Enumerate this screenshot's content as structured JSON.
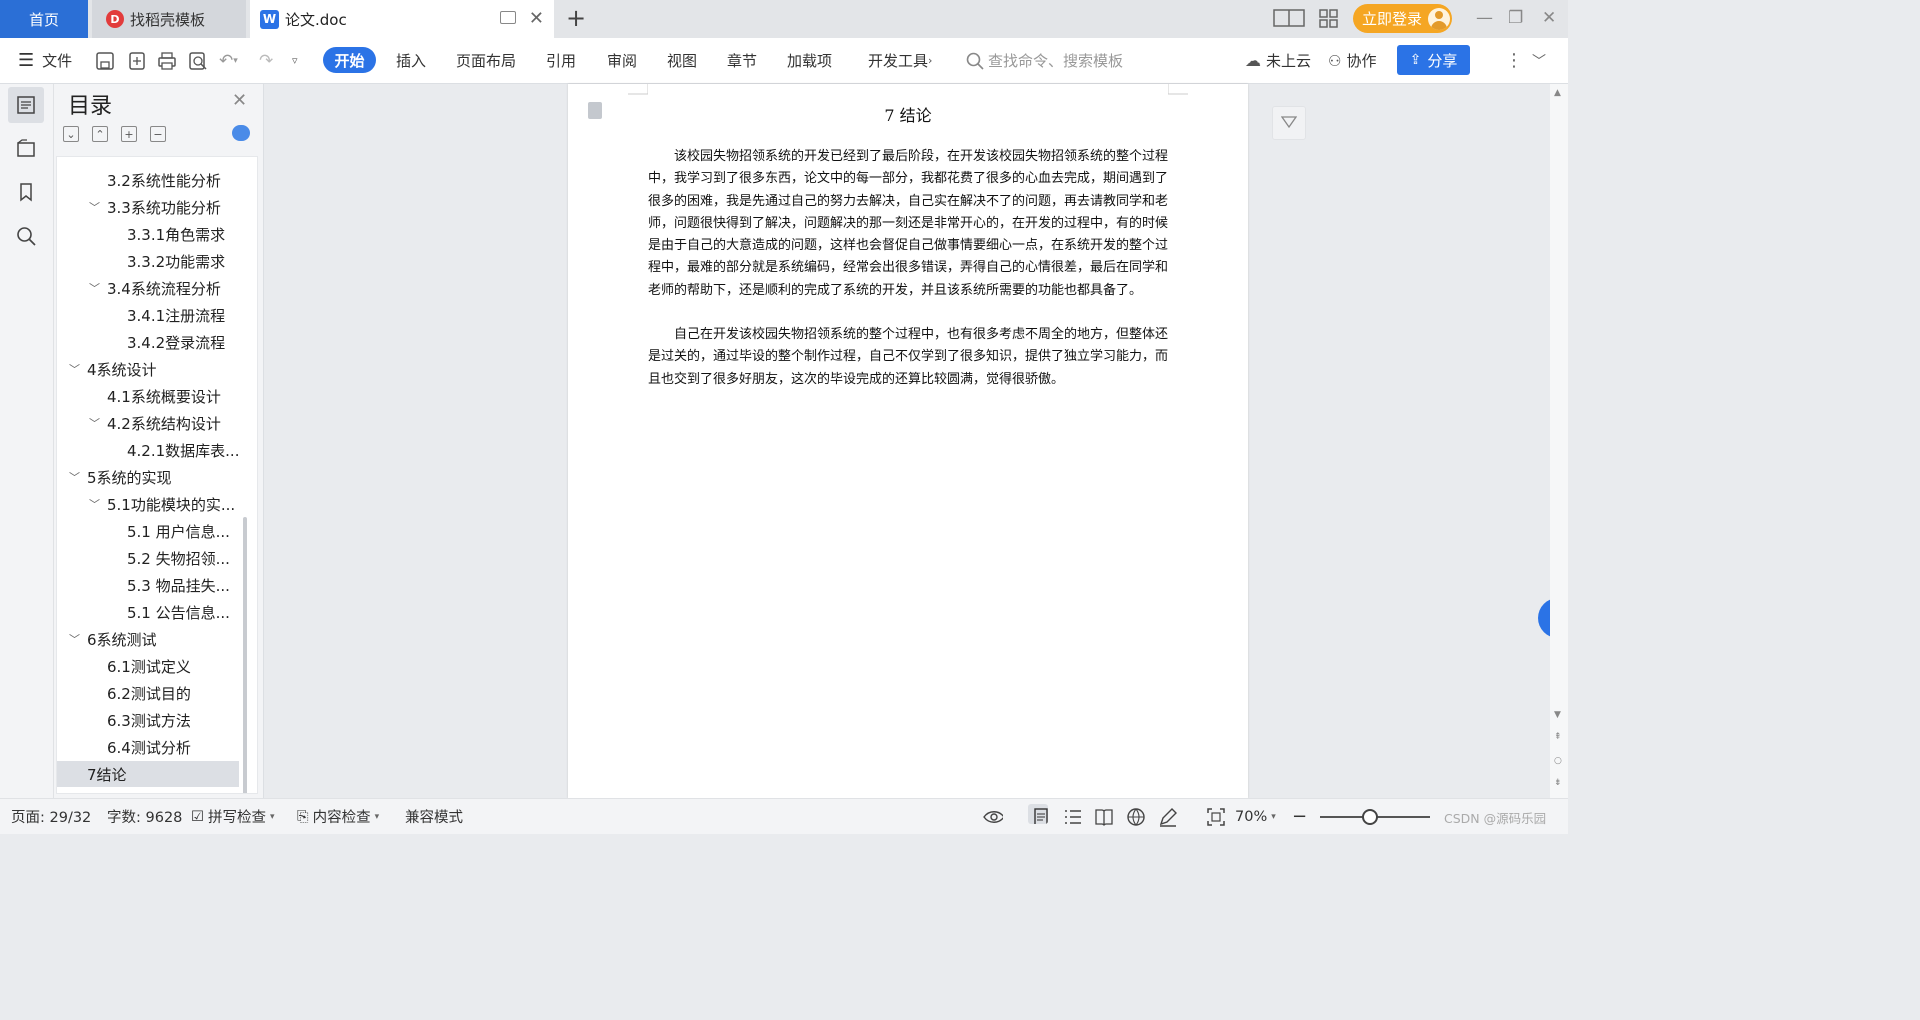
{
  "tabs": {
    "home": "首页",
    "templates": "找稻壳模板",
    "document": "论文.doc",
    "new_tab": "+"
  },
  "account": {
    "login_label": "立即登录"
  },
  "ribbon": {
    "file": "文件",
    "menus": [
      "开始",
      "插入",
      "页面布局",
      "引用",
      "审阅",
      "视图",
      "章节",
      "加载项",
      "开发工具"
    ],
    "search_placeholder": "查找命令、搜索模板",
    "cloud": "未上云",
    "collab": "协作",
    "share": "分享"
  },
  "toc": {
    "title": "目录",
    "items": [
      {
        "label": "3.2系统性能分析",
        "level": 2,
        "expandable": false
      },
      {
        "label": "3.3系统功能分析",
        "level": 2,
        "expandable": true
      },
      {
        "label": "3.3.1角色需求",
        "level": 3,
        "expandable": false
      },
      {
        "label": "3.3.2功能需求",
        "level": 3,
        "expandable": false
      },
      {
        "label": "3.4系统流程分析",
        "level": 2,
        "expandable": true
      },
      {
        "label": "3.4.1注册流程",
        "level": 3,
        "expandable": false
      },
      {
        "label": "3.4.2登录流程",
        "level": 3,
        "expandable": false
      },
      {
        "label": "4系统设计",
        "level": 1,
        "expandable": true
      },
      {
        "label": "4.1系统概要设计",
        "level": 2,
        "expandable": false
      },
      {
        "label": "4.2系统结构设计",
        "level": 2,
        "expandable": true
      },
      {
        "label": "4.2.1数据库表...",
        "level": 3,
        "expandable": false
      },
      {
        "label": "5系统的实现",
        "level": 1,
        "expandable": true
      },
      {
        "label": "5.1功能模块的实...",
        "level": 2,
        "expandable": true
      },
      {
        "label": "5.1 用户信息...",
        "level": 3,
        "expandable": false
      },
      {
        "label": "5.2  失物招领...",
        "level": 3,
        "expandable": false
      },
      {
        "label": "5.3 物品挂失...",
        "level": 3,
        "expandable": false
      },
      {
        "label": "5.1 公告信息...",
        "level": 3,
        "expandable": false
      },
      {
        "label": "6系统测试",
        "level": 1,
        "expandable": true
      },
      {
        "label": "6.1测试定义",
        "level": 2,
        "expandable": false
      },
      {
        "label": "6.2测试目的",
        "level": 2,
        "expandable": false
      },
      {
        "label": "6.3测试方法",
        "level": 2,
        "expandable": false
      },
      {
        "label": "6.4测试分析",
        "level": 2,
        "expandable": false
      },
      {
        "label": "7结论",
        "level": 1,
        "expandable": false,
        "selected": true
      }
    ]
  },
  "document": {
    "heading": "7  结论",
    "paragraphs": [
      "该校园失物招领系统的开发已经到了最后阶段，在开发该校园失物招领系统的整个过程中，我学习到了很多东西，论文中的每一部分，我都花费了很多的心血去完成，期间遇到了很多的困难，我是先通过自己的努力去解决，自己实在解决不了的问题，再去请教同学和老师，问题很快得到了解决，问题解决的那一刻还是非常开心的，在开发的过程中，有的时候是由于自己的大意造成的问题，这样也会督促自己做事情要细心一点，在系统开发的整个过程中，最难的部分就是系统编码，经常会出很多错误，弄得自己的心情很差，最后在同学和老师的帮助下，还是顺利的完成了系统的开发，并且该系统所需要的功能也都具备了。",
      "自己在开发该校园失物招领系统的整个过程中，也有很多考虑不周全的地方，但整体还是过关的，通过毕设的整个制作过程，自己不仅学到了很多知识，提供了独立学习能力，而且也交到了很多好朋友，这次的毕设完成的还算比较圆满，觉得很骄傲。"
    ]
  },
  "status": {
    "page": "页面: 29/32",
    "words": "字数: 9628",
    "spell": "拼写检查",
    "content_check": "内容检查",
    "compat": "兼容模式",
    "zoom": "70%",
    "zoom_fraction": 0.45
  },
  "watermark": "CSDN @源码乐园",
  "colors": {
    "accent": "#2b73e6",
    "login": "#f5a623",
    "home_tab": "#2b6fd6"
  }
}
